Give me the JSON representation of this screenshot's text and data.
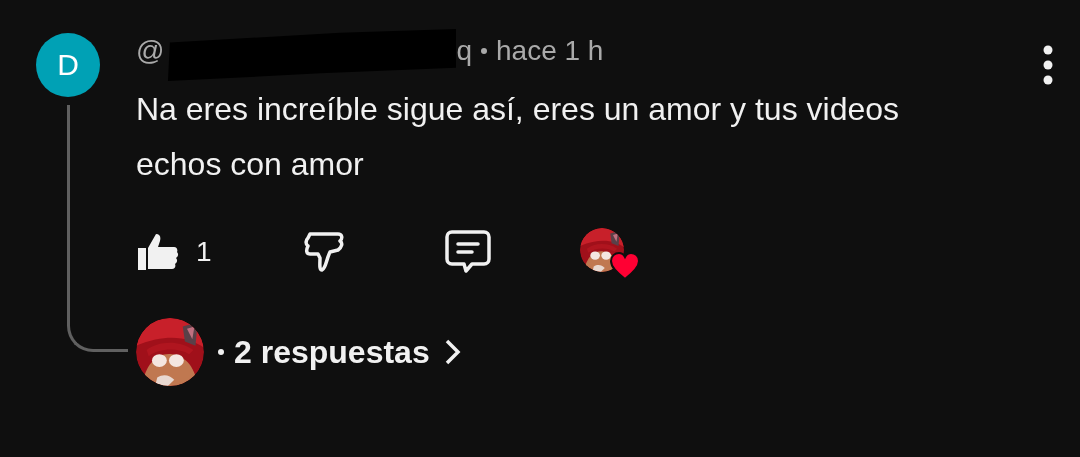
{
  "comment": {
    "avatar_letter": "D",
    "handle_start": "@",
    "handle_redacted": true,
    "handle_end": "q",
    "time": "hace 1 h",
    "text": "Na eres increíble sigue así, eres un amor y tus videos echos con amor",
    "likes": "1",
    "creator_hearted": true
  },
  "replies": {
    "label": "2 respuestas"
  }
}
